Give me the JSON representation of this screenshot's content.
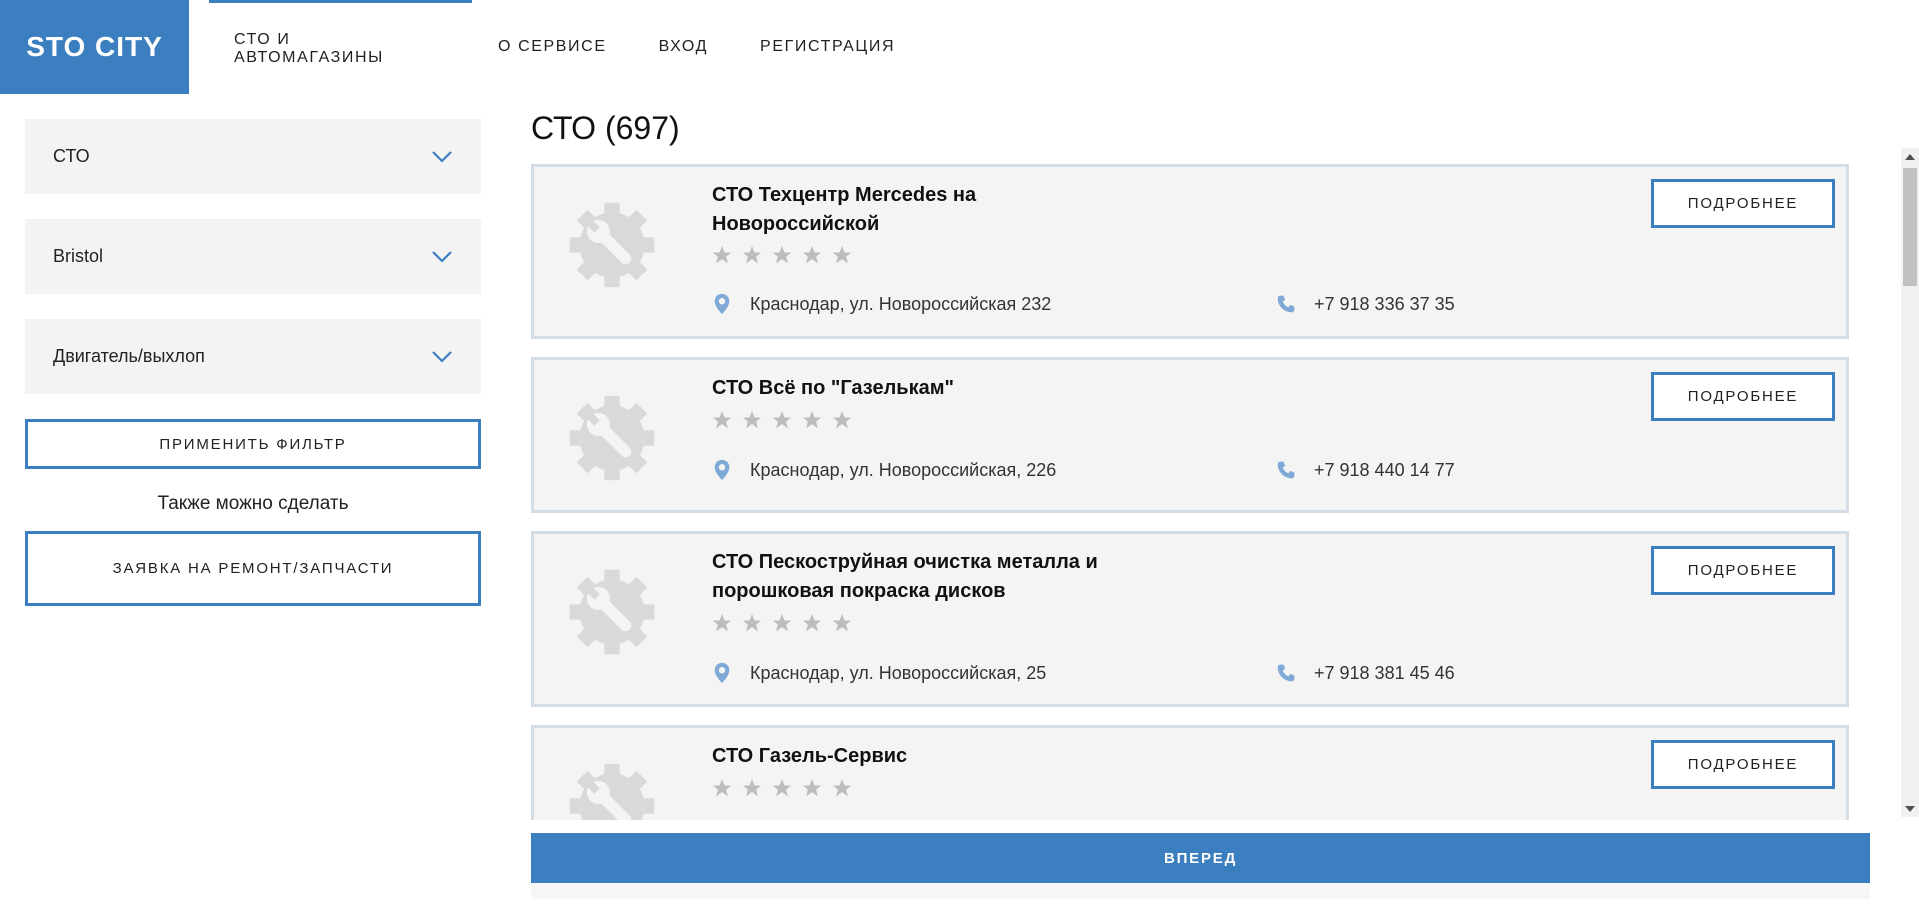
{
  "header": {
    "logo": "STO CITY",
    "nav": [
      {
        "label": "СТО И АВТОМАГАЗИНЫ",
        "active": true
      },
      {
        "label": "О СЕРВИСЕ"
      },
      {
        "label": "ВХОД"
      },
      {
        "label": "РЕГИСТРАЦИЯ"
      }
    ]
  },
  "sidebar": {
    "filters": [
      {
        "value": "СТО"
      },
      {
        "value": "Bristol"
      },
      {
        "value": "Двигатель/выхлоп"
      }
    ],
    "apply_label": "ПРИМЕНИТЬ ФИЛЬТР",
    "also_text": "Также можно сделать",
    "request_label": "ЗАЯВКА НА РЕМОНТ/ЗАПЧАСТИ"
  },
  "main": {
    "title": "СТО (697)",
    "more_label": "ПОДРОБНЕЕ",
    "cards": [
      {
        "title": "СТО Техцентр Mercedes на Новороссийской",
        "address": "Краснодар, ул. Новороссийская 232",
        "phone": "+7 918 336 37 35",
        "rating": 0
      },
      {
        "title": "СТО Всё по \"Газелькам\"",
        "address": "Краснодар, ул. Новороссийская, 226",
        "phone": "+7 918 440 14 77",
        "rating": 0
      },
      {
        "title": "СТО Пескоструйная очистка металла и порошковая покраска дисков",
        "address": "Краснодар, ул. Новороссийская, 25",
        "phone": "+7 918 381 45 46",
        "rating": 0
      },
      {
        "title": "СТО Газель-Сервис",
        "address": "",
        "phone": "",
        "rating": 0
      }
    ],
    "forward_label": "ВПЕРЕД"
  },
  "icons": {
    "placeholder": "gear-wrench-icon",
    "location": "map-pin-icon",
    "phone": "phone-icon",
    "star": "star-icon",
    "chevron": "chevron-down-icon"
  },
  "colors": {
    "accent": "#3b7fc1",
    "card_bg": "#f4f4f4",
    "card_border": "#d4dde6",
    "star": "#bdbdbd",
    "icon_blue": "#7fa9d6"
  }
}
